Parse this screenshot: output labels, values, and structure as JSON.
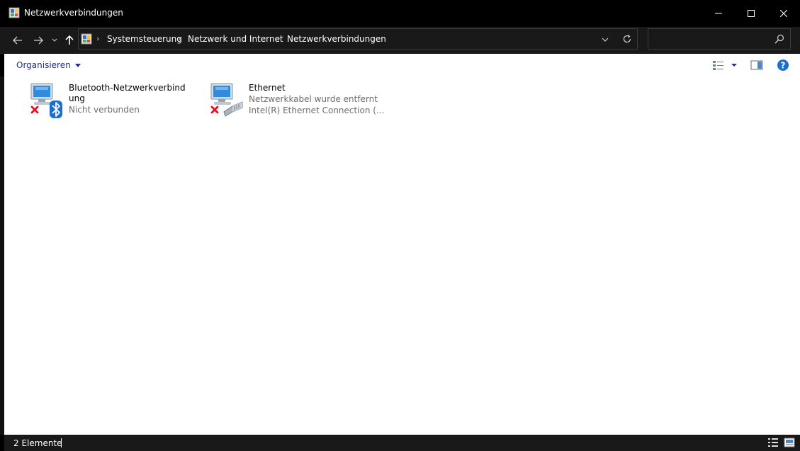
{
  "window": {
    "title": "Netzwerkverbindungen",
    "icons": {
      "app": "control-panel-icon",
      "minimize": "minimize-icon",
      "maximize": "maximize-icon",
      "close": "close-icon"
    }
  },
  "navigation": {
    "breadcrumbs": [
      "Systemsteuerung",
      "Netzwerk und Internet",
      "Netzwerkverbindungen"
    ],
    "search_placeholder": ""
  },
  "commandbar": {
    "organize_label": "Organisieren"
  },
  "connections": [
    {
      "name": "Bluetooth-Netzwerkverbindung",
      "status": "Nicht verbunden",
      "adapter": "",
      "icon": "bluetooth-network-icon",
      "badge": "disconnected-x-icon"
    },
    {
      "name": "Ethernet",
      "status": "Netzwerkkabel wurde entfernt",
      "adapter": "Intel(R) Ethernet Connection (...",
      "icon": "ethernet-network-icon",
      "badge": "disconnected-x-icon"
    }
  ],
  "statusbar": {
    "item_count": "2 Elemente"
  },
  "colors": {
    "titlebar_bg": "#000000",
    "navbar_bg": "#191919",
    "content_bg": "#ffffff",
    "link_blue": "#1e3287",
    "status_grey": "#6d6d6d",
    "error_red": "#e81123",
    "help_blue": "#1a6fd1"
  }
}
